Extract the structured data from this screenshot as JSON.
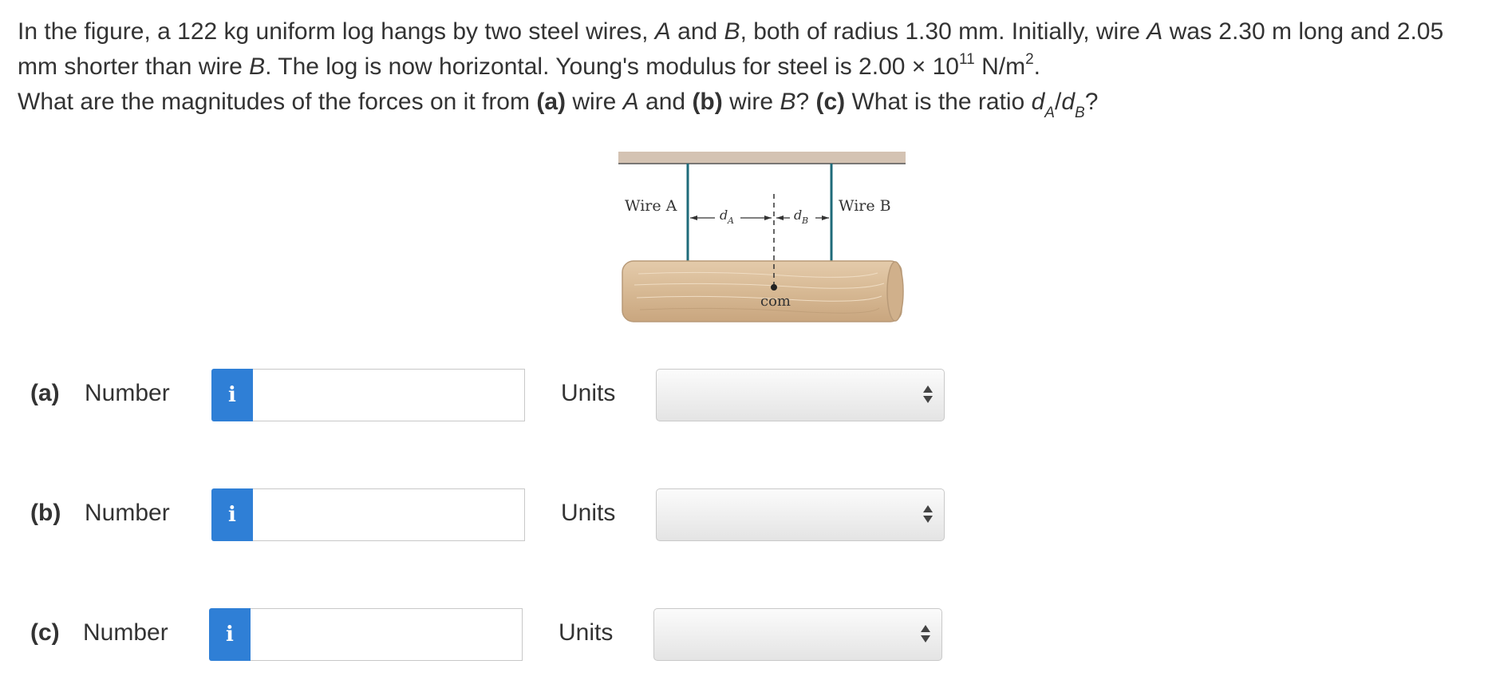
{
  "question": {
    "intro_1": "In the figure, a ",
    "mass": "122 kg",
    "intro_2": " uniform log hangs by two steel wires, ",
    "wire_a_letter": "A",
    "and_1": " and ",
    "wire_b_letter": "B",
    "intro_3": ", both of radius ",
    "radius": "1.30 mm",
    "intro_4": ". Initially, wire ",
    "wire_a_letter_2": "A",
    "intro_5": " was ",
    "length": "2.30 m",
    "intro_6": " long and ",
    "shorter_by": "2.05 mm",
    "intro_7": " shorter than wire ",
    "wire_b_letter_2": "B",
    "intro_8": ". The log is now horizontal. Young's modulus for steel is ",
    "modulus_mantissa": "2.00 × 10",
    "modulus_exponent": "11",
    "modulus_unit": " N/m",
    "modulus_unit_exp": "2",
    "period": ".",
    "ask_1": "What are the magnitudes of the forces on it from ",
    "part_a": "(a)",
    "ask_2": " wire ",
    "ask_a_letter": "A",
    "ask_3": " and ",
    "part_b": "(b)",
    "ask_4": " wire ",
    "ask_b_letter": "B",
    "ask_5": "? ",
    "part_c": "(c)",
    "ask_6": " What is the ratio ",
    "ratio_d1": "d",
    "ratio_sub1": "A",
    "ratio_slash": "/",
    "ratio_d2": "d",
    "ratio_sub2": "B",
    "ask_7": "?"
  },
  "figure": {
    "wire_a_label": "Wire A",
    "wire_b_label": "Wire B",
    "da_label": "d",
    "da_sub": "A",
    "db_label": "d",
    "db_sub": "B",
    "com_label": "com",
    "colors": {
      "ceiling": "#d4c3b3",
      "wire": "#1f6b7a",
      "log": "#d9bb98",
      "log_edge": "#b89a78"
    }
  },
  "rows": [
    {
      "part": "(a)",
      "number_label": "Number",
      "info_icon": "i",
      "value": "",
      "units_label": "Units",
      "units_selected": ""
    },
    {
      "part": "(b)",
      "number_label": "Number",
      "info_icon": "i",
      "value": "",
      "units_label": "Units",
      "units_selected": ""
    },
    {
      "part": "(c)",
      "number_label": "Number",
      "info_icon": "i",
      "value": "",
      "units_label": "Units",
      "units_selected": ""
    }
  ],
  "colors": {
    "info_button": "#2f7fd6",
    "text": "#333333"
  }
}
